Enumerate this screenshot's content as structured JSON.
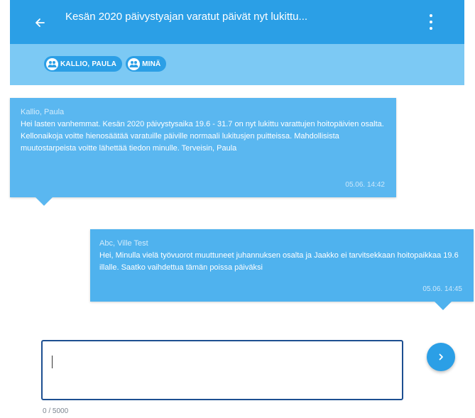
{
  "header": {
    "title": "Kesän 2020 päivystyajan varatut päivät nyt lukittu...",
    "back_icon": "arrow-left-icon",
    "menu_icon": "more-vertical-icon"
  },
  "participants": [
    {
      "label": "KALLIO, PAULA",
      "icon": "group-icon"
    },
    {
      "label": "MINÄ",
      "icon": "group-icon"
    }
  ],
  "messages": [
    {
      "sender": "Kallio, Paula",
      "body": "Hei lasten vanhemmat. Kesän 2020 päivystysaika 19.6 - 31.7 on nyt lukittu varattujen hoitopäivien osalta. Kellonaikoja voitte hienosäätää varatuille päiville normaali lukitusjen puitteissa. Mahdollisista muutostarpeista voitte lähettää tiedon minulle. Terveisin, Paula",
      "time": "05.06. 14:42"
    },
    {
      "sender": "Abc, Ville Test",
      "body": "Hei, Minulla vielä työvuorot muuttuneet juhannuksen osalta ja Jaakko ei tarvitsekkaan hoitopaikkaa 19.6 illalle. Saatko vaihdettua tämän poissa päiväksi",
      "time": "05.06. 14:45"
    }
  ],
  "composer": {
    "value": "",
    "counter": "0 / 5000",
    "send_icon": "chevron-right-icon"
  },
  "colors": {
    "primary": "#2b9fe6",
    "participants_bar": "#7cc9f4",
    "bubble": "#5ab7f0",
    "input_border": "#1d4f91"
  }
}
